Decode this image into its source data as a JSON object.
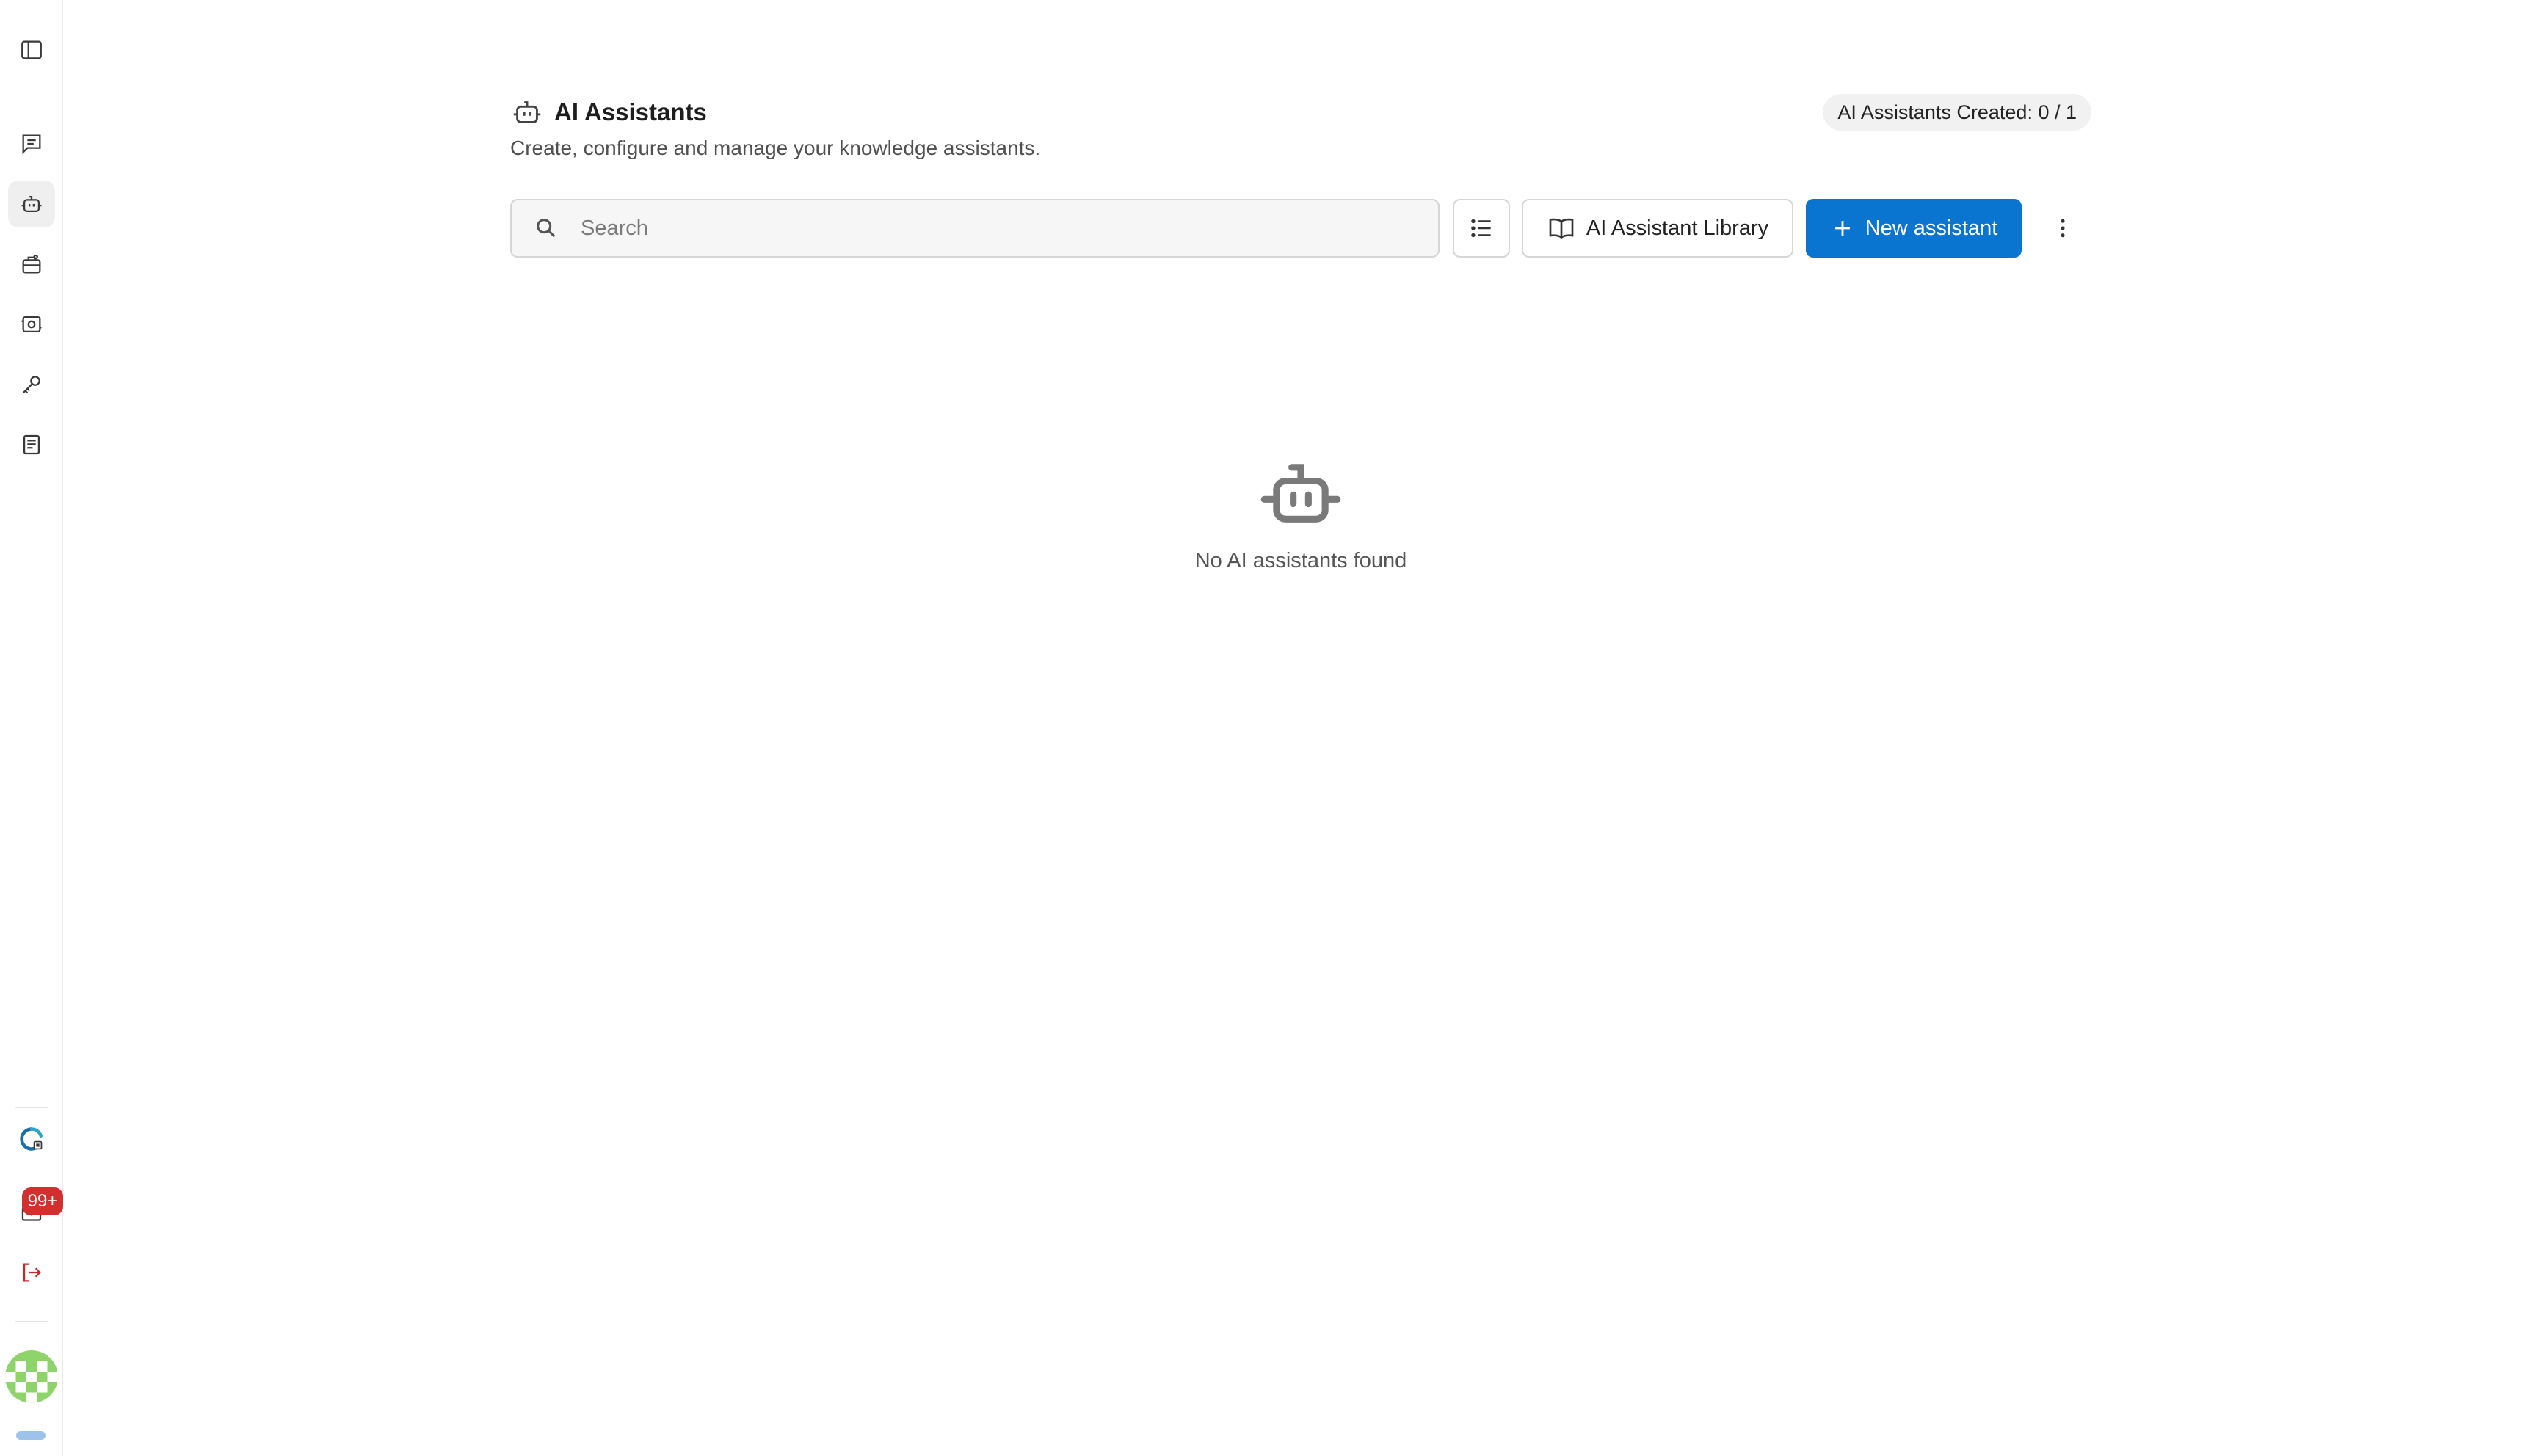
{
  "app": {
    "icons": {
      "sidebar_toggle": "sidebar-toggle-icon",
      "chat": "chat-icon",
      "assistants": "robot-icon",
      "tools": "toolbox-icon",
      "scan": "scan-icon",
      "keys": "key-icon",
      "docs": "document-icon",
      "logo": "app-logo-icon",
      "inbox": "mail-icon",
      "logout": "logout-icon"
    },
    "accent_color": "#0a74d1",
    "badge_color": "#d32f2f"
  },
  "sidebar": {
    "inbox_badge": "99+"
  },
  "header": {
    "title": "AI Assistants",
    "subtitle": "Create, configure and manage your knowledge assistants.",
    "quota": "AI Assistants Created: 0 / 1"
  },
  "toolbar": {
    "search_placeholder": "Search",
    "search_value": "",
    "library_label": "AI Assistant Library",
    "new_label": "New assistant"
  },
  "empty_state": {
    "message": "No AI assistants found"
  }
}
